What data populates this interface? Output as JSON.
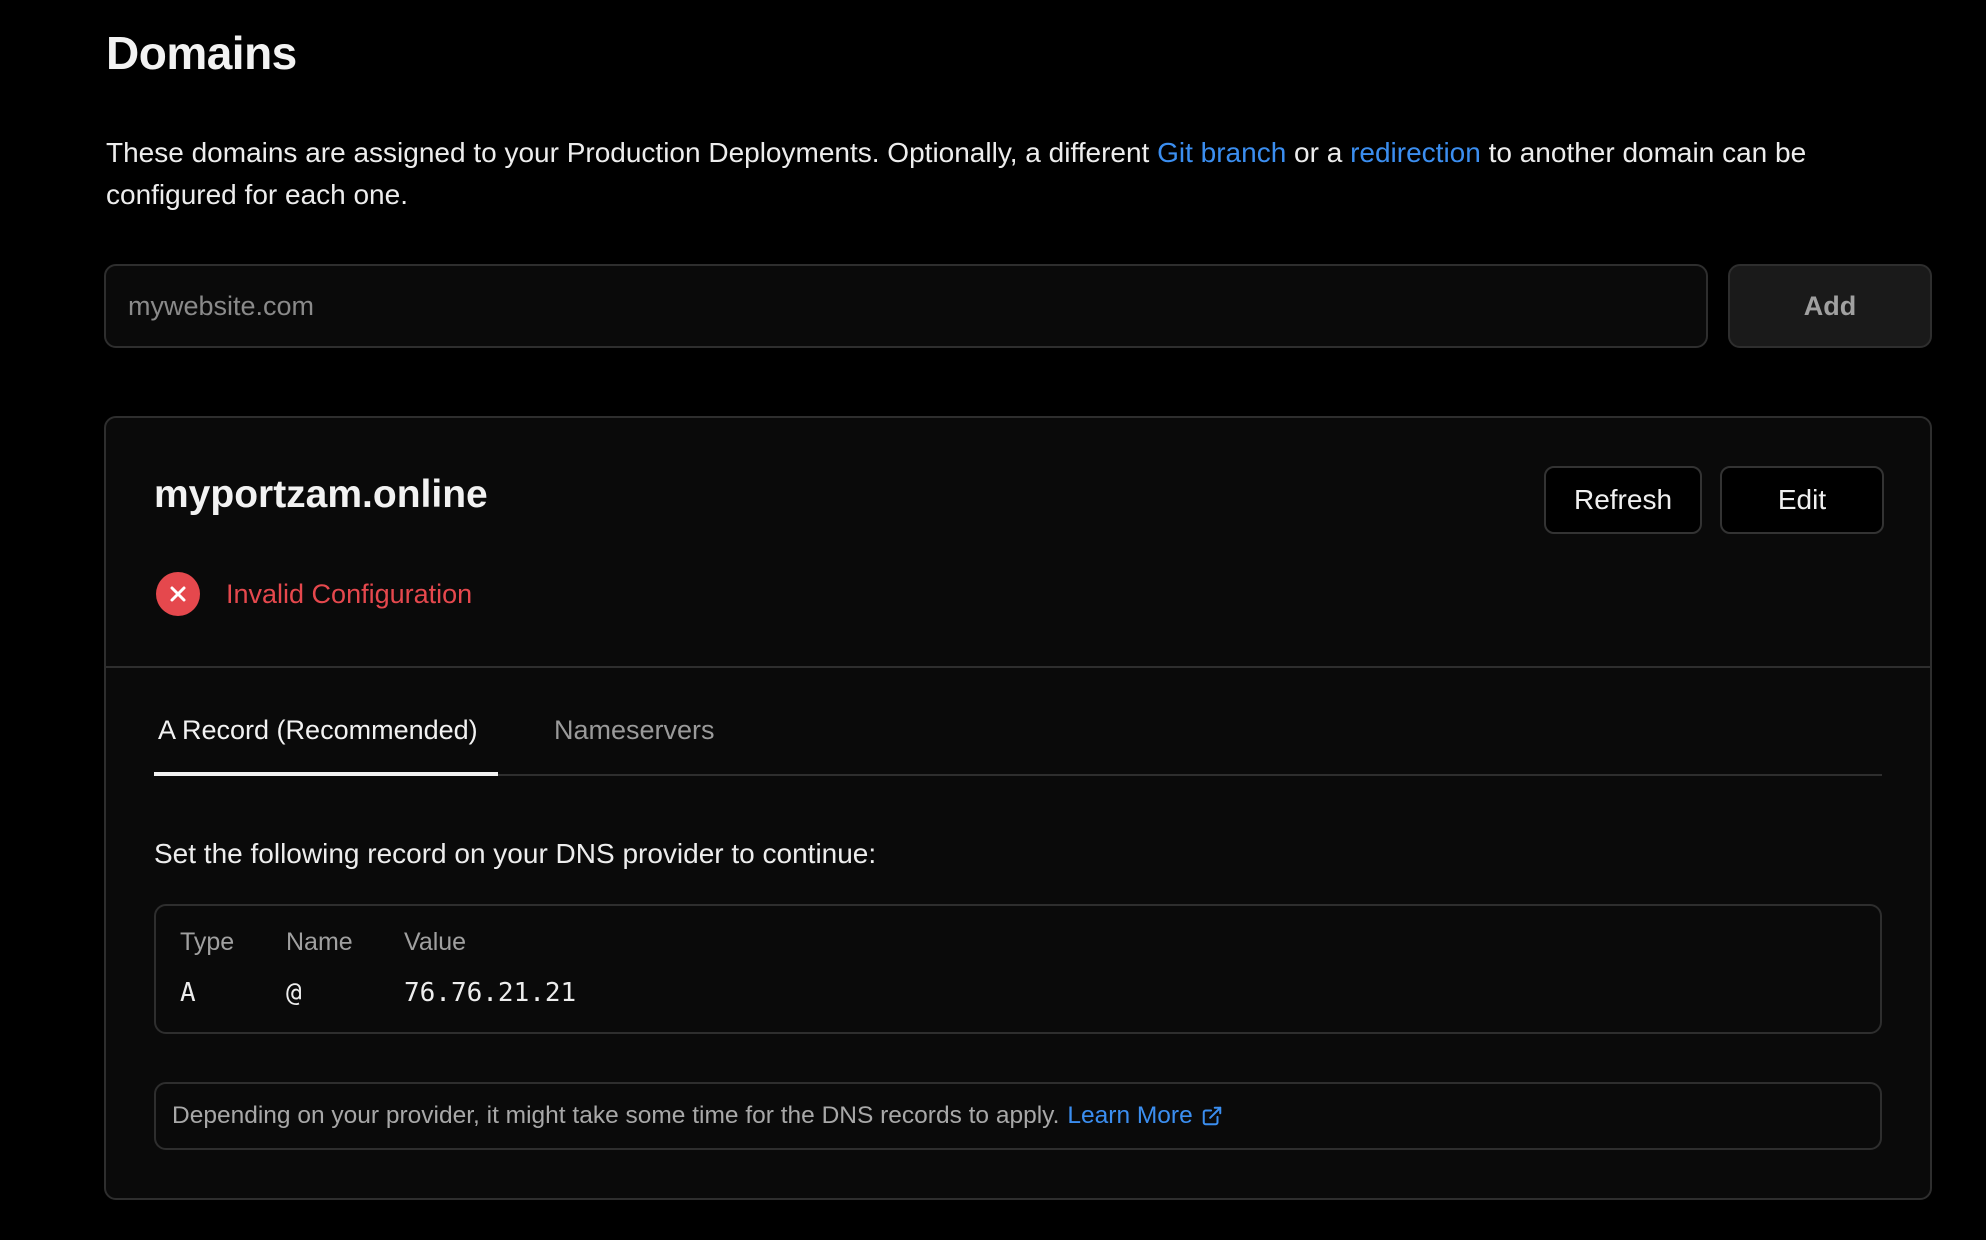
{
  "page": {
    "title": "Domains",
    "description": {
      "part1": "These domains are assigned to your Production Deployments. Optionally, a different ",
      "link1": "Git branch",
      "part2": " or a ",
      "link2": "redirection",
      "part3": " to another domain can be configured for each one."
    }
  },
  "add_domain": {
    "placeholder": "mywebsite.com",
    "value": "",
    "button_label": "Add"
  },
  "domain_card": {
    "domain": "myportzam.online",
    "refresh_label": "Refresh",
    "edit_label": "Edit",
    "status": {
      "text": "Invalid Configuration",
      "icon": "x-circle-icon",
      "color": "#e5484d"
    },
    "tabs": [
      {
        "label": "A Record (Recommended)",
        "active": true
      },
      {
        "label": "Nameservers",
        "active": false
      }
    ],
    "instruction": "Set the following record on your DNS provider to continue:",
    "record": {
      "headers": [
        "Type",
        "Name",
        "Value"
      ],
      "row": [
        "A",
        "@",
        "76.76.21.21"
      ]
    },
    "note": {
      "text": "Depending on your provider, it might take some time for the DNS records to apply.",
      "link_label": "Learn More",
      "link_icon": "external-link-icon"
    }
  },
  "colors": {
    "background": "#000000",
    "card": "#0a0a0a",
    "border": "#2e2e2e",
    "link": "#3b8ef0",
    "error": "#e5484d"
  }
}
